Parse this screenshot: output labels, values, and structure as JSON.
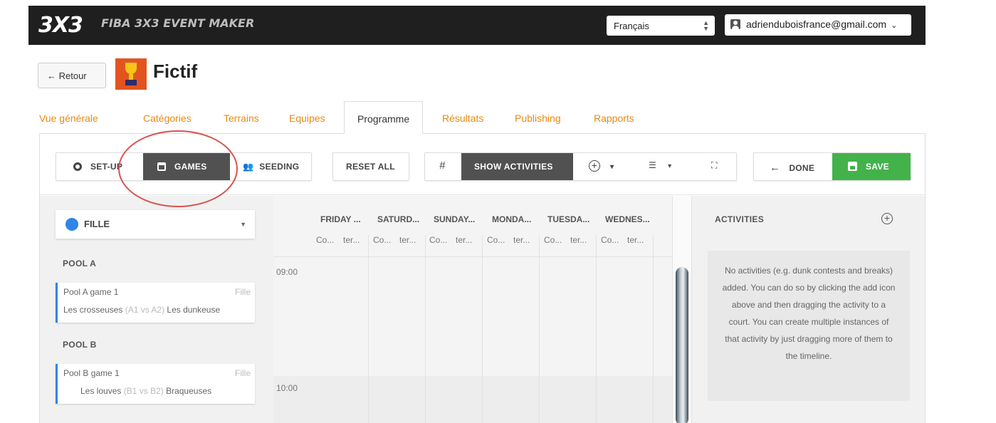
{
  "topbar": {
    "logo": "3X3",
    "app_title": "FIBA 3X3 EVENT MAKER",
    "language": "Français",
    "user_email": "adrienduboisfrance@gmail.com"
  },
  "header": {
    "back_label": "← Retour",
    "event_name": "Fictif"
  },
  "tabs": [
    {
      "label": "Vue générale"
    },
    {
      "label": "Catégories"
    },
    {
      "label": "Terrains"
    },
    {
      "label": "Equipes"
    },
    {
      "label": "Programme",
      "active": true
    },
    {
      "label": "Résultats"
    },
    {
      "label": "Publishing"
    },
    {
      "label": "Rapports"
    }
  ],
  "toolbar": {
    "setup_label": "SET-UP",
    "games_label": "GAMES",
    "seeding_label": "SEEDING",
    "reset_label": "RESET ALL",
    "hash_label": "#",
    "show_activities_label": "SHOW ACTIVITIES",
    "add_caret": "▾",
    "filter_caret": "▾",
    "filter_icon": "☰",
    "fullscreen_icon": "⛶",
    "done_label": "DONE",
    "save_label": "SAVE"
  },
  "left_panel": {
    "category": "FILLE",
    "pools": [
      {
        "title": "POOL A",
        "games": [
          {
            "name": "Pool A game 1",
            "category": "Fille",
            "team1": "Les crosseuses",
            "vs": "(A1 vs A2)",
            "team2": "Les dunkeuse"
          }
        ]
      },
      {
        "title": "POOL B",
        "games": [
          {
            "name": "Pool B game 1",
            "category": "Fille",
            "team1": "Les louves",
            "vs": "(B1 vs B2)",
            "team2": "Braqueuses"
          }
        ]
      }
    ]
  },
  "schedule": {
    "days": [
      "FRIDAY ...",
      "SATURD...",
      "SUNDAY...",
      "MONDA...",
      "TUESDA...",
      "WEDNES..."
    ],
    "courts": [
      "Co...",
      "ter..."
    ],
    "times": [
      "09:00",
      "10:00"
    ]
  },
  "activities": {
    "title": "ACTIVITIES",
    "empty_text": "No activities (e.g. dunk contests and breaks) added. You can do so by clicking the add icon above and then dragging the activity to a court. You can create multiple instances of that activity by just dragging more of them to the timeline."
  },
  "colors": {
    "accent_orange": "#e88a12",
    "save_green": "#43b24a",
    "category_blue": "#2f86e8",
    "topbar_bg": "#1f1f1f",
    "annotation_red": "#d9534f"
  }
}
